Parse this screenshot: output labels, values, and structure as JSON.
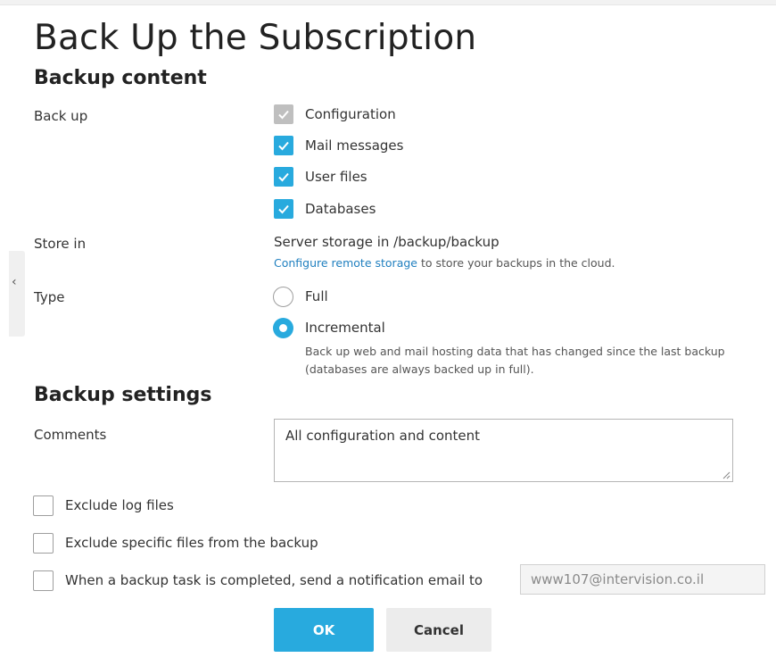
{
  "page": {
    "title": "Back Up the Subscription"
  },
  "backup_content": {
    "heading": "Backup content",
    "back_up_label": "Back up",
    "items": [
      {
        "label": "Configuration",
        "checked": true,
        "disabled": true
      },
      {
        "label": "Mail messages",
        "checked": true,
        "disabled": false
      },
      {
        "label": "User files",
        "checked": true,
        "disabled": false
      },
      {
        "label": "Databases",
        "checked": true,
        "disabled": false
      }
    ],
    "store_in_label": "Store in",
    "store_in_value": "Server storage in /backup/backup",
    "remote_link": "Configure remote storage",
    "remote_suffix": " to store your backups in the cloud.",
    "type_label": "Type",
    "type_options": [
      {
        "label": "Full",
        "selected": false
      },
      {
        "label": "Incremental",
        "selected": true
      }
    ],
    "incremental_hint_line1": "Back up web and mail hosting data that has changed since the last backup",
    "incremental_hint_line2": "(databases are always backed up in full)."
  },
  "backup_settings": {
    "heading": "Backup settings",
    "comments_label": "Comments",
    "comments_value": "All configuration and content",
    "exclude_log_files": {
      "label": "Exclude log files",
      "checked": false
    },
    "exclude_specific": {
      "label": "Exclude specific files from the backup",
      "checked": false
    },
    "notify": {
      "label": "When a backup task is completed, send a notification email to",
      "checked": false
    },
    "notify_email": "www107@intervision.co.il"
  },
  "actions": {
    "ok_label": "OK",
    "cancel_label": "Cancel"
  },
  "colors": {
    "accent": "#28aade",
    "link": "#1f7fbf",
    "disabled_checkbox": "#bfbfbf"
  },
  "icons": {
    "side_tab": "chevron-left-icon",
    "checkbox_mark": "checkmark-icon",
    "textarea_grip": "resize-grip-icon"
  }
}
